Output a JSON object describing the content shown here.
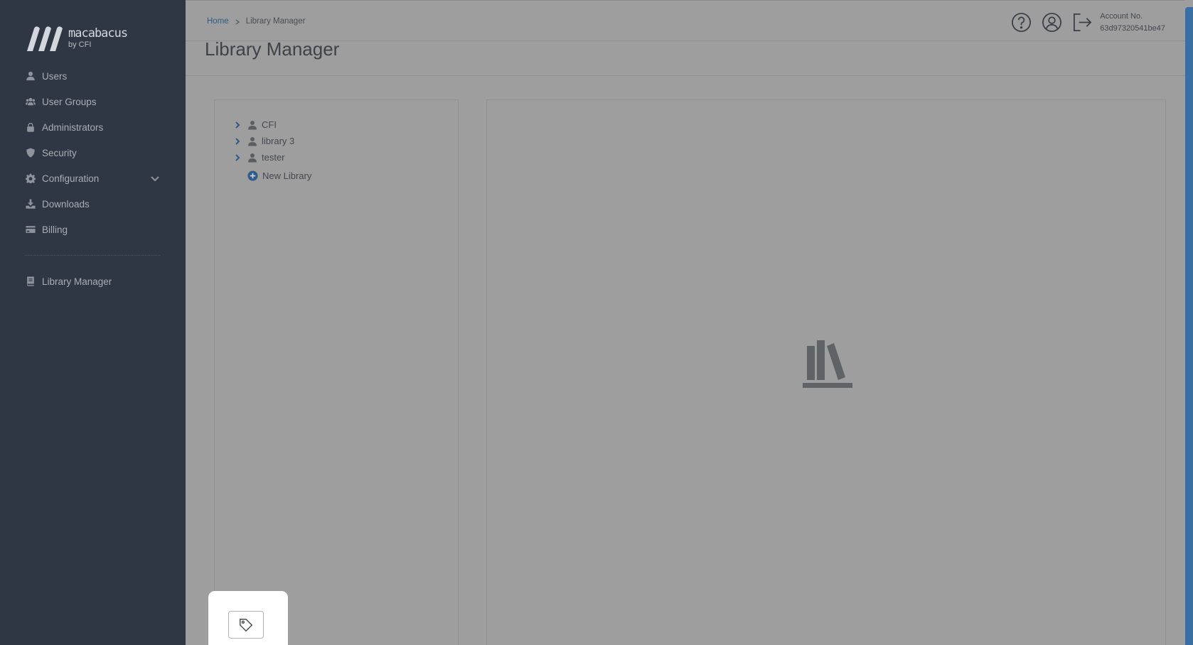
{
  "brand": {
    "name": "macabacus",
    "sub": "by CFI"
  },
  "sidebar": {
    "items": [
      {
        "label": "Users",
        "icon": "user-icon"
      },
      {
        "label": "User Groups",
        "icon": "users-icon"
      },
      {
        "label": "Administrators",
        "icon": "lock-icon"
      },
      {
        "label": "Security",
        "icon": "shield-icon"
      },
      {
        "label": "Configuration",
        "icon": "gear-icon",
        "expandable": true
      },
      {
        "label": "Downloads",
        "icon": "download-icon"
      },
      {
        "label": "Billing",
        "icon": "credit-card-icon"
      }
    ],
    "secondary": [
      {
        "label": "Library Manager",
        "icon": "book-icon"
      }
    ]
  },
  "header": {
    "breadcrumb": {
      "home": "Home",
      "current": "Library Manager"
    },
    "account_label": "Account No.",
    "account_number": "63d97320541be47"
  },
  "page": {
    "title": "Library Manager"
  },
  "tree": {
    "items": [
      {
        "label": "CFI"
      },
      {
        "label": "library 3"
      },
      {
        "label": "tester"
      }
    ],
    "new_label": "New Library"
  },
  "colors": {
    "sidebar_bg": "#303744",
    "accent": "#2f5b88",
    "overlay_bg": "#9e9e9e"
  }
}
